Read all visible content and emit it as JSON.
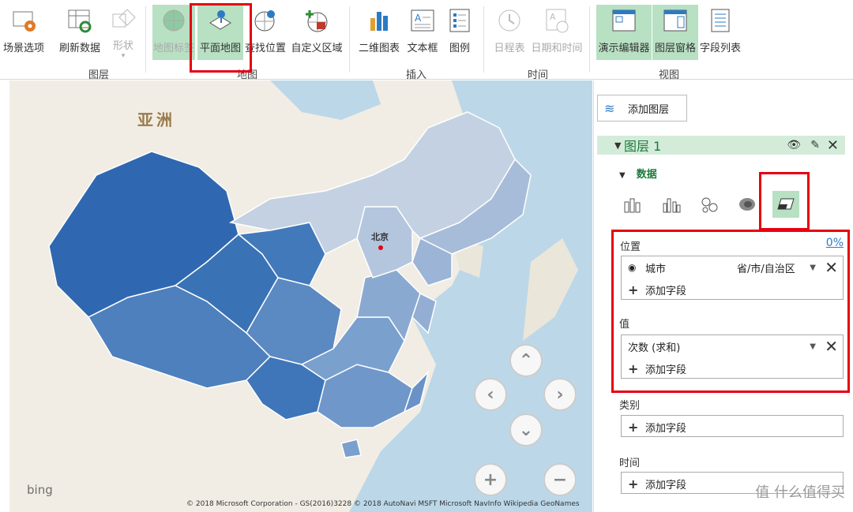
{
  "ribbon": {
    "buttons": {
      "scene_options": "场景选项",
      "refresh_data": "刷新数据",
      "shapes": "形状",
      "map_labels": "地图标签",
      "flat_map": "平面地图",
      "find_location": "查找位置",
      "custom_region": "自定义区域",
      "chart_2d": "二维图表",
      "text_box": "文本框",
      "legend": "图例",
      "timeline": "日程表",
      "date_time": "日期和时间",
      "tour_editor": "演示编辑器",
      "layer_pane": "图层窗格",
      "field_list": "字段列表"
    },
    "groups": {
      "layer": "图层",
      "map": "地图",
      "insert": "插入",
      "time": "时间",
      "view": "视图"
    }
  },
  "map": {
    "asia_label": "亚洲",
    "capital_label": "北京",
    "bing_logo": "bing",
    "copyright": "© 2018 Microsoft Corporation - GS(2016)3228 © 2018 AutoNavi  MSFT  Microsoft  NavInfo  Wikipedia  GeoNames"
  },
  "pane": {
    "add_layer": "添加图层",
    "layer_name": "图层 1",
    "data_section": "数据",
    "location_label": "位置",
    "location_percent": "0%",
    "location_field": "城市",
    "location_type": "省/市/自治区",
    "add_field": "添加字段",
    "value_label": "值",
    "value_field": "次数 (求和)",
    "category_label": "类别",
    "time_label": "时间"
  },
  "watermark": "值 什么值得买",
  "colors": {
    "accent_green": "#1e7a3b",
    "ribbon_selected": "#b8e0c3",
    "highlight_red": "#e60012",
    "province_dark": "#2f68b0",
    "province_light": "#c3d1e2"
  }
}
